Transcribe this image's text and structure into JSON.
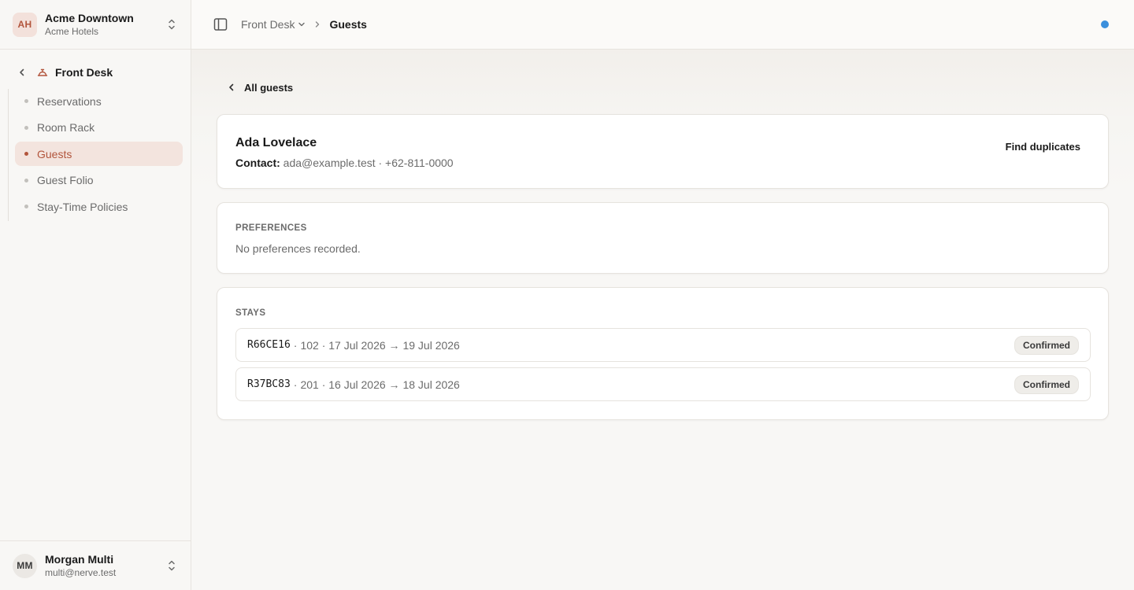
{
  "org": {
    "initials": "AH",
    "name": "Acme Downtown",
    "subtitle": "Acme Hotels"
  },
  "nav": {
    "section": "Front Desk",
    "items": [
      {
        "label": "Reservations",
        "active": false
      },
      {
        "label": "Room Rack",
        "active": false
      },
      {
        "label": "Guests",
        "active": true
      },
      {
        "label": "Guest Folio",
        "active": false
      },
      {
        "label": "Stay-Time Policies",
        "active": false
      }
    ]
  },
  "user": {
    "initials": "MM",
    "name": "Morgan Multi",
    "email": "multi@nerve.test"
  },
  "breadcrumb": {
    "parent": "Front Desk",
    "current": "Guests"
  },
  "page": {
    "back_label": "All guests"
  },
  "guest": {
    "name": "Ada Lovelace",
    "contact_label": "Contact:",
    "contact_value": "ada@example.test · +62-811-0000",
    "find_duplicates": "Find duplicates"
  },
  "preferences": {
    "title": "PREFERENCES",
    "empty": "No preferences recorded."
  },
  "stays": {
    "title": "STAYS",
    "rows": [
      {
        "code": "R66CE16",
        "detail": "102 · 17 Jul 2026 → 19 Jul 2026",
        "status": "Confirmed"
      },
      {
        "code": "R37BC83",
        "detail": "201 · 16 Jul 2026 → 18 Jul 2026",
        "status": "Confirmed"
      }
    ]
  },
  "colors": {
    "accent": "#b2553c",
    "status_dot": "#3b8fdc"
  },
  "icons": {
    "org_switcher": "chevron-up-down-icon",
    "section": "concierge-bell-icon",
    "sidebar_toggle": "panel-left-icon",
    "back": "chevron-left-icon"
  }
}
